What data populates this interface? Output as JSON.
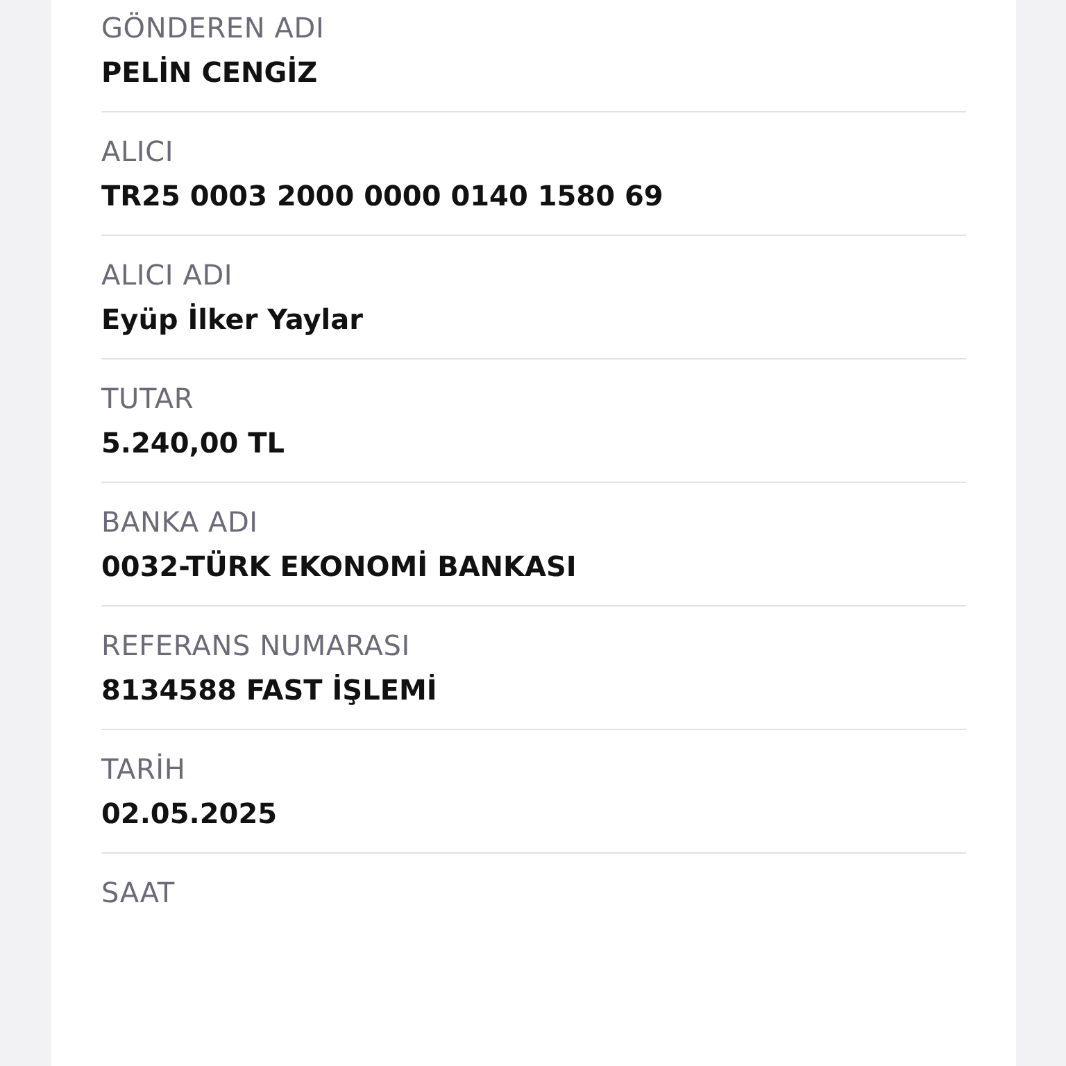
{
  "fields": [
    {
      "label": "GÖNDEREN ADI",
      "value": "PELİN CENGİZ"
    },
    {
      "label": "ALICI",
      "value": "TR25 0003 2000 0000 0140 1580 69"
    },
    {
      "label": "ALICI ADI",
      "value": "Eyüp İlker Yaylar"
    },
    {
      "label": "TUTAR",
      "value": "5.240,00 TL"
    },
    {
      "label": "BANKA ADI",
      "value": "0032-TÜRK EKONOMİ BANKASI"
    },
    {
      "label": "REFERANS NUMARASI",
      "value": "8134588 FAST İŞLEMİ"
    },
    {
      "label": "TARİH",
      "value": "02.05.2025"
    },
    {
      "label": "SAAT"
    }
  ]
}
